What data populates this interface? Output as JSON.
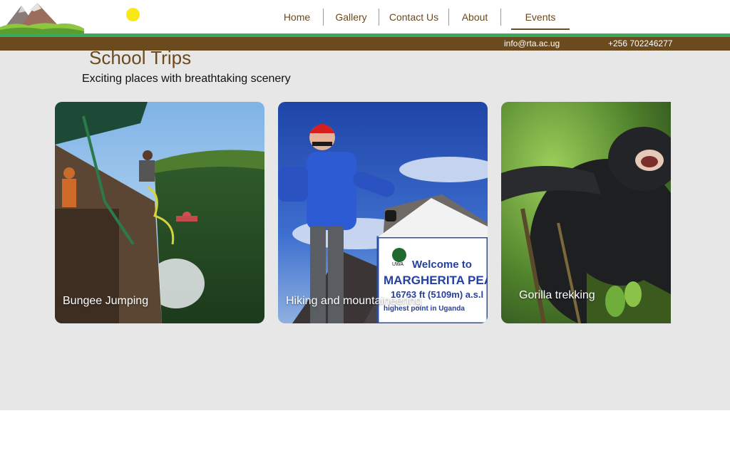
{
  "header": {
    "nav": [
      {
        "label": "Home"
      },
      {
        "label": "Gallery"
      },
      {
        "label": "Contact Us"
      },
      {
        "label": "About"
      },
      {
        "label": "Events"
      }
    ],
    "active_nav": "Events",
    "contact": {
      "email": "info@rta.ac.ug",
      "phone": "+256 702246277"
    }
  },
  "main": {
    "title": "School Trips",
    "subtitle": "Exciting places with breathtaking scenery",
    "cards": [
      {
        "label": "Bungee Jumping"
      },
      {
        "label": "Hiking and mountaineering"
      },
      {
        "label": "Gorilla trekking"
      }
    ],
    "sign_text": {
      "line1": "Welcome to",
      "line2": "MARGHERITA PEAK",
      "line3": "16763 ft (5109m) a.s.l",
      "line4": "highest point in Uganda",
      "badge": "UWA"
    }
  },
  "colors": {
    "brand_brown": "#6b4a1e",
    "accent_green": "#3aaa5a",
    "content_bg": "#e8e7e7",
    "sun": "#f7e816"
  },
  "icons": {
    "logo": "mountain-logo-icon",
    "sun": "sun-icon"
  }
}
